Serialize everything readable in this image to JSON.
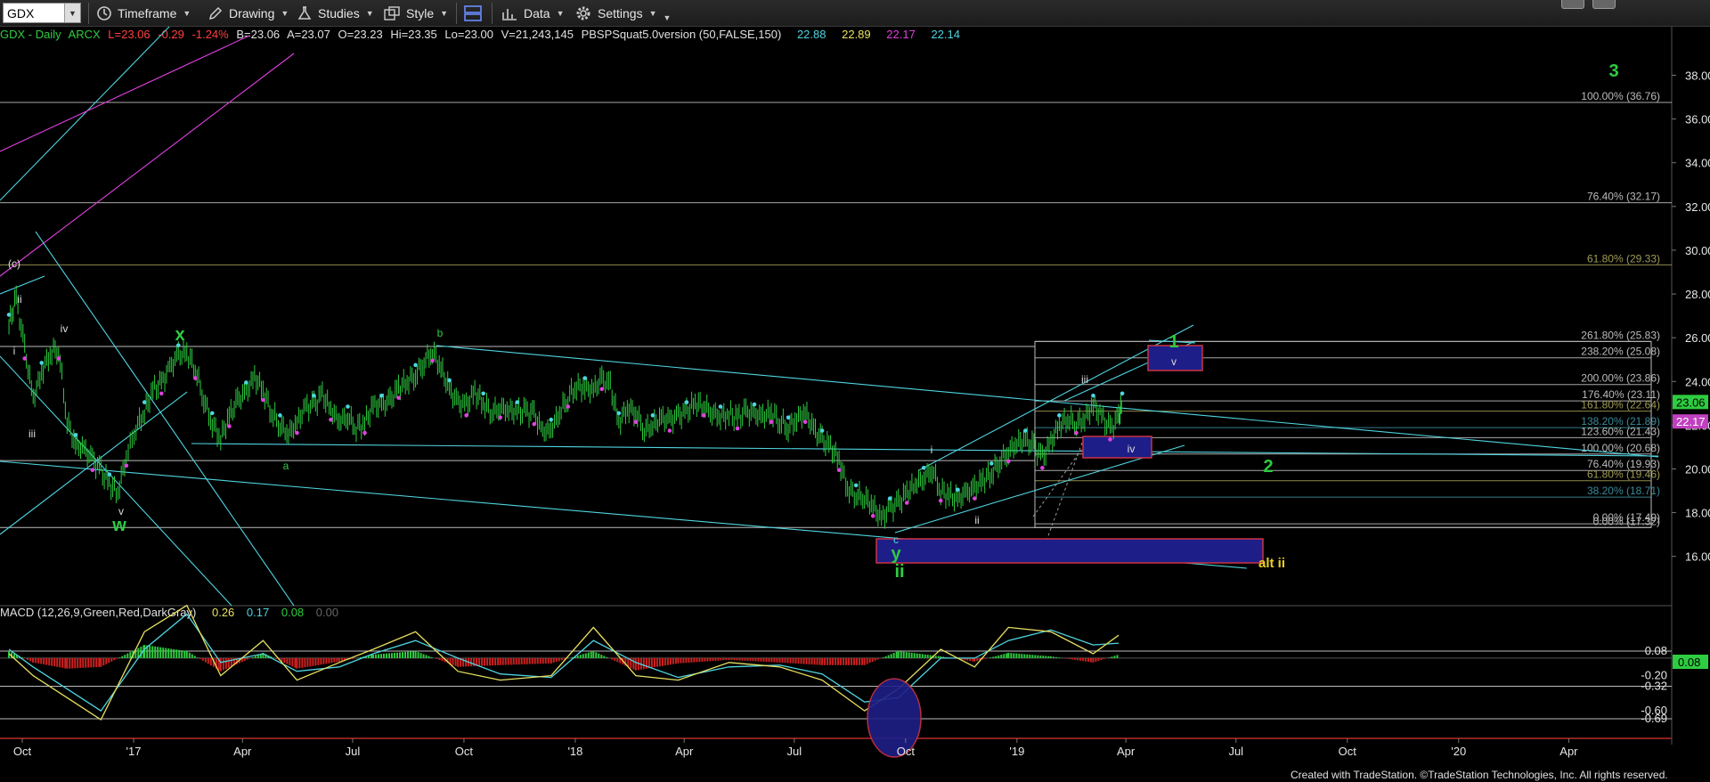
{
  "toolbar": {
    "symbol": "GDX",
    "items": [
      {
        "label": "Timeframe",
        "icon": "clock-icon"
      },
      {
        "label": "Drawing",
        "icon": "pencil-icon"
      },
      {
        "label": "Studies",
        "icon": "flask-icon"
      },
      {
        "label": "Style",
        "icon": "style-icon"
      },
      {
        "label": "",
        "icon": "layout-icon"
      },
      {
        "label": "Data",
        "icon": "data-bars-icon"
      },
      {
        "label": "Settings",
        "icon": "gear-icon"
      }
    ]
  },
  "infobar": {
    "symbol": "GDX - Daily",
    "exchange": "ARCX",
    "last": "L=23.06",
    "change": "-0.29",
    "change_pct": "-1.24%",
    "bid": "B=23.06",
    "ask": "A=23.07",
    "open": "O=23.23",
    "high": "Hi=23.35",
    "low": "Lo=23.00",
    "volume": "V=21,243,145",
    "study": "PBSPSquat5.0version (50,FALSE,150)",
    "study_values": [
      "22.88",
      "22.89",
      "22.17",
      "22.14"
    ],
    "study_colors": [
      "#4fd4e0",
      "#e8e060",
      "#e040e0",
      "#4fd4e0"
    ]
  },
  "macd_label": {
    "name": "MACD (12,26,9,Green,Red,DarkGray)",
    "values": [
      "0.26",
      "0.17",
      "0.08",
      "0.00"
    ],
    "colors": [
      "#e8e060",
      "#4fd4e0",
      "#2ecc40",
      "#666666"
    ]
  },
  "footer": "Created with TradeStation. ©TradeStation Technologies, Inc. All rights reserved.",
  "chart_data": {
    "type": "candlestick",
    "ylim": [
      14.5,
      39.5
    ],
    "y_ticks": [
      "38.00",
      "36.00",
      "34.00",
      "32.00",
      "30.00",
      "28.00",
      "26.00",
      "24.00",
      "22.00",
      "20.00",
      "18.00",
      "16.00"
    ],
    "x_ticks": [
      "Oct",
      "'17",
      "Apr",
      "Jul",
      "Oct",
      "'18",
      "Apr",
      "Jul",
      "Oct",
      "'19",
      "Apr",
      "Jul",
      "Oct",
      "'20",
      "Apr"
    ],
    "last_price_tag": {
      "value": 23.06,
      "label": "23.06",
      "color": "#2ecc40"
    },
    "study_price_tag": {
      "value": 22.17,
      "label": "22.17",
      "color": "#c040c0"
    },
    "fib_levels": [
      {
        "label": "100.00% (36.76)",
        "value": 36.76,
        "color": "#bbbbbb"
      },
      {
        "label": "76.40% (32.17)",
        "value": 32.17,
        "color": "#bbbbbb"
      },
      {
        "label": "61.80% (29.33)",
        "value": 29.33,
        "color": "#a09a55"
      },
      {
        "label": "261.80% (25.83)",
        "value": 25.83,
        "color": "#bbbbbb"
      },
      {
        "label": "238.20% (25.08)",
        "value": 25.08,
        "color": "#bbbbbb"
      },
      {
        "label": "200.00% (23.86)",
        "value": 23.86,
        "color": "#bbbbbb"
      },
      {
        "label": "176.40% (23.11)",
        "value": 23.11,
        "color": "#bbbbbb"
      },
      {
        "label": "161.80% (22.64)",
        "value": 22.64,
        "color": "#a09a55"
      },
      {
        "label": "138.20% (21.89)",
        "value": 21.89,
        "color": "#3a8a9a"
      },
      {
        "label": "123.60% (21.43)",
        "value": 21.43,
        "color": "#bbbbbb"
      },
      {
        "label": "100.00% (20.68)",
        "value": 20.68,
        "color": "#bbbbbb"
      },
      {
        "label": "76.40% (19.93)",
        "value": 19.93,
        "color": "#bbbbbb"
      },
      {
        "label": "61.80% (19.46)",
        "value": 19.46,
        "color": "#a09a55"
      },
      {
        "label": "38.20% (18.71)",
        "value": 18.71,
        "color": "#3a8a9a"
      },
      {
        "label": "0.00% (17.49)",
        "value": 17.49,
        "color": "#bbbbbb"
      },
      {
        "label": "0.00% (17.32)",
        "value": 17.32,
        "color": "#bbbbbb"
      }
    ],
    "wave_labels": [
      {
        "text": "3",
        "color": "#2ecc40",
        "size": "big"
      },
      {
        "text": "1",
        "color": "#2ecc40",
        "size": "big"
      },
      {
        "text": "2",
        "color": "#2ecc40",
        "size": "big"
      },
      {
        "text": "x",
        "color": "#2ecc40",
        "size": "big"
      },
      {
        "text": "w",
        "color": "#2ecc40",
        "size": "big"
      },
      {
        "text": "y",
        "color": "#2ecc40",
        "size": "big"
      },
      {
        "text": "ii",
        "color": "#2ecc40",
        "size": "big"
      },
      {
        "text": "alt ii",
        "color": "#e8d020",
        "size": "mid"
      },
      {
        "text": "a",
        "color": "#2ecc40",
        "size": "small"
      },
      {
        "text": "b",
        "color": "#2ecc40",
        "size": "small"
      },
      {
        "text": "c",
        "color": "#4fd4e0",
        "size": "small"
      },
      {
        "text": "(c)",
        "color": "#dddddd",
        "size": "small"
      },
      {
        "text": "ii",
        "color": "#dddddd",
        "size": "small"
      },
      {
        "text": "i",
        "color": "#dddddd",
        "size": "small"
      },
      {
        "text": "iv",
        "color": "#dddddd",
        "size": "small"
      },
      {
        "text": "iii",
        "color": "#dddddd",
        "size": "small"
      },
      {
        "text": "v",
        "color": "#dddddd",
        "size": "small"
      },
      {
        "text": "i",
        "color": "#dddddd",
        "size": "small"
      },
      {
        "text": "ii",
        "color": "#dddddd",
        "size": "small"
      },
      {
        "text": "iii",
        "color": "#dddddd",
        "size": "small"
      },
      {
        "text": "iv",
        "color": "#dddddd",
        "size": "small"
      },
      {
        "text": "v",
        "color": "#dddddd",
        "size": "small"
      }
    ],
    "price_path": [
      [
        "2016-09-20",
        26.6
      ],
      [
        "2016-09-26",
        27.8
      ],
      [
        "2016-10-03",
        25.5
      ],
      [
        "2016-10-10",
        23.2
      ],
      [
        "2016-10-17",
        24.4
      ],
      [
        "2016-10-24",
        25.3
      ],
      [
        "2016-10-31",
        25.5
      ],
      [
        "2016-11-07",
        22.2
      ],
      [
        "2016-11-14",
        21.1
      ],
      [
        "2016-11-21",
        20.9
      ],
      [
        "2016-11-28",
        20.4
      ],
      [
        "2016-12-05",
        19.9
      ],
      [
        "2016-12-12",
        19.3
      ],
      [
        "2016-12-19",
        18.9
      ],
      [
        "2016-12-26",
        20.6
      ],
      [
        "2017-01-03",
        21.9
      ],
      [
        "2017-01-10",
        22.6
      ],
      [
        "2017-01-17",
        23.6
      ],
      [
        "2017-01-24",
        23.9
      ],
      [
        "2017-01-31",
        24.6
      ],
      [
        "2017-02-07",
        25.2
      ],
      [
        "2017-02-14",
        25.3
      ],
      [
        "2017-02-21",
        24.6
      ],
      [
        "2017-02-28",
        23.2
      ],
      [
        "2017-03-07",
        22.1
      ],
      [
        "2017-03-14",
        21.4
      ],
      [
        "2017-03-21",
        22.4
      ],
      [
        "2017-03-28",
        23.1
      ],
      [
        "2017-04-04",
        23.5
      ],
      [
        "2017-04-11",
        24.2
      ],
      [
        "2017-04-18",
        23.6
      ],
      [
        "2017-04-25",
        22.6
      ],
      [
        "2017-05-02",
        22.0
      ],
      [
        "2017-05-09",
        21.6
      ],
      [
        "2017-05-16",
        22.1
      ],
      [
        "2017-05-23",
        22.8
      ],
      [
        "2017-05-30",
        22.9
      ],
      [
        "2017-06-06",
        23.4
      ],
      [
        "2017-06-13",
        22.7
      ],
      [
        "2017-06-20",
        22.2
      ],
      [
        "2017-06-27",
        22.4
      ],
      [
        "2017-07-04",
        21.9
      ],
      [
        "2017-07-11",
        22.1
      ],
      [
        "2017-07-18",
        22.9
      ],
      [
        "2017-07-25",
        22.9
      ],
      [
        "2017-08-01",
        23.1
      ],
      [
        "2017-08-08",
        23.7
      ],
      [
        "2017-08-15",
        24.0
      ],
      [
        "2017-08-22",
        24.3
      ],
      [
        "2017-08-29",
        24.9
      ],
      [
        "2017-09-05",
        25.4
      ],
      [
        "2017-09-12",
        24.6
      ],
      [
        "2017-09-19",
        23.6
      ],
      [
        "2017-09-26",
        23.0
      ],
      [
        "2017-10-03",
        22.9
      ],
      [
        "2017-10-10",
        23.5
      ],
      [
        "2017-10-17",
        23.0
      ],
      [
        "2017-10-24",
        22.6
      ],
      [
        "2017-10-31",
        22.8
      ],
      [
        "2017-11-07",
        22.7
      ],
      [
        "2017-11-14",
        22.6
      ],
      [
        "2017-11-21",
        22.6
      ],
      [
        "2017-11-28",
        22.5
      ],
      [
        "2017-12-05",
        21.7
      ],
      [
        "2017-12-12",
        21.8
      ],
      [
        "2017-12-19",
        22.6
      ],
      [
        "2017-12-26",
        23.3
      ],
      [
        "2018-01-02",
        23.8
      ],
      [
        "2018-01-09",
        23.7
      ],
      [
        "2018-01-16",
        23.6
      ],
      [
        "2018-01-23",
        24.1
      ],
      [
        "2018-01-30",
        23.8
      ],
      [
        "2018-02-06",
        22.1
      ],
      [
        "2018-02-13",
        22.8
      ],
      [
        "2018-02-20",
        22.6
      ],
      [
        "2018-02-27",
        21.8
      ],
      [
        "2018-03-06",
        22.0
      ],
      [
        "2018-03-13",
        22.3
      ],
      [
        "2018-03-20",
        22.2
      ],
      [
        "2018-03-27",
        22.4
      ],
      [
        "2018-04-03",
        22.6
      ],
      [
        "2018-04-10",
        23.0
      ],
      [
        "2018-04-17",
        22.9
      ],
      [
        "2018-04-24",
        22.6
      ],
      [
        "2018-05-01",
        22.4
      ],
      [
        "2018-05-08",
        22.5
      ],
      [
        "2018-05-15",
        22.3
      ],
      [
        "2018-05-22",
        22.6
      ],
      [
        "2018-05-29",
        22.5
      ],
      [
        "2018-06-05",
        22.4
      ],
      [
        "2018-06-12",
        22.6
      ],
      [
        "2018-06-19",
        22.2
      ],
      [
        "2018-06-26",
        21.9
      ],
      [
        "2018-07-03",
        22.3
      ],
      [
        "2018-07-10",
        22.6
      ],
      [
        "2018-07-17",
        21.8
      ],
      [
        "2018-07-24",
        21.3
      ],
      [
        "2018-07-31",
        21.0
      ],
      [
        "2018-08-07",
        20.4
      ],
      [
        "2018-08-14",
        19.1
      ],
      [
        "2018-08-21",
        18.8
      ],
      [
        "2018-08-28",
        18.7
      ],
      [
        "2018-09-04",
        18.3
      ],
      [
        "2018-09-11",
        17.7
      ],
      [
        "2018-09-18",
        18.2
      ],
      [
        "2018-09-25",
        18.4
      ],
      [
        "2018-10-02",
        18.9
      ],
      [
        "2018-10-09",
        19.3
      ],
      [
        "2018-10-16",
        19.6
      ],
      [
        "2018-10-23",
        20.0
      ],
      [
        "2018-10-30",
        19.0
      ],
      [
        "2018-11-06",
        18.8
      ],
      [
        "2018-11-13",
        18.6
      ],
      [
        "2018-11-20",
        18.9
      ],
      [
        "2018-11-27",
        19.1
      ],
      [
        "2018-12-04",
        19.5
      ],
      [
        "2018-12-11",
        19.8
      ],
      [
        "2018-12-18",
        20.4
      ],
      [
        "2018-12-25",
        20.8
      ],
      [
        "2019-01-01",
        21.2
      ],
      [
        "2019-01-08",
        21.3
      ],
      [
        "2019-01-15",
        21.0
      ],
      [
        "2019-01-22",
        20.5
      ],
      [
        "2019-01-29",
        21.2
      ],
      [
        "2019-02-05",
        22.0
      ],
      [
        "2019-02-12",
        22.3
      ],
      [
        "2019-02-19",
        22.1
      ],
      [
        "2019-02-26",
        22.3
      ],
      [
        "2019-03-05",
        22.9
      ],
      [
        "2019-03-12",
        22.4
      ],
      [
        "2019-03-19",
        21.8
      ],
      [
        "2019-03-26",
        22.3
      ],
      [
        "2019-03-29",
        23.0
      ]
    ],
    "macd_ylim": [
      -0.75,
      0.75
    ],
    "macd_ticks": [
      "0.08",
      "-0.20",
      "-0.32",
      "-0.60",
      "-0.69"
    ],
    "macd_tags": [
      {
        "label": "0.08",
        "value": 0.08,
        "color": "#2ecc40"
      }
    ],
    "macd_lines": [
      0.08,
      -0.32,
      -0.69
    ],
    "macd_histogram": [
      [
        "2016-09-20",
        0.08
      ],
      [
        "2016-10-10",
        -0.05
      ],
      [
        "2016-11-07",
        -0.12
      ],
      [
        "2016-12-05",
        -0.1
      ],
      [
        "2017-01-10",
        0.15
      ],
      [
        "2017-02-14",
        0.08
      ],
      [
        "2017-03-14",
        -0.15
      ],
      [
        "2017-04-18",
        0.06
      ],
      [
        "2017-05-16",
        -0.12
      ],
      [
        "2017-06-20",
        -0.04
      ],
      [
        "2017-07-18",
        0.04
      ],
      [
        "2017-08-22",
        0.08
      ],
      [
        "2017-09-26",
        -0.1
      ],
      [
        "2017-10-31",
        -0.08
      ],
      [
        "2017-12-12",
        -0.06
      ],
      [
        "2018-01-16",
        0.08
      ],
      [
        "2018-02-20",
        -0.14
      ],
      [
        "2018-03-27",
        -0.06
      ],
      [
        "2018-05-08",
        -0.02
      ],
      [
        "2018-06-19",
        -0.05
      ],
      [
        "2018-07-24",
        -0.08
      ],
      [
        "2018-08-28",
        -0.08
      ],
      [
        "2018-09-25",
        0.08
      ],
      [
        "2018-10-30",
        0.02
      ],
      [
        "2018-11-27",
        -0.04
      ],
      [
        "2018-12-25",
        0.06
      ],
      [
        "2019-01-29",
        0.02
      ],
      [
        "2019-03-05",
        -0.05
      ],
      [
        "2019-03-26",
        0.04
      ]
    ],
    "macd_line": [
      [
        "2016-09-20",
        0.05
      ],
      [
        "2016-10-10",
        -0.2
      ],
      [
        "2016-11-07",
        -0.45
      ],
      [
        "2016-12-05",
        -0.7
      ],
      [
        "2017-01-10",
        0.3
      ],
      [
        "2017-02-14",
        0.6
      ],
      [
        "2017-03-14",
        -0.2
      ],
      [
        "2017-04-18",
        0.2
      ],
      [
        "2017-05-16",
        -0.25
      ],
      [
        "2017-06-20",
        -0.05
      ],
      [
        "2017-07-18",
        0.1
      ],
      [
        "2017-08-22",
        0.3
      ],
      [
        "2017-09-26",
        -0.15
      ],
      [
        "2017-10-31",
        -0.25
      ],
      [
        "2017-12-12",
        -0.2
      ],
      [
        "2018-01-16",
        0.35
      ],
      [
        "2018-02-20",
        -0.2
      ],
      [
        "2018-03-27",
        -0.25
      ],
      [
        "2018-05-08",
        -0.05
      ],
      [
        "2018-06-19",
        -0.1
      ],
      [
        "2018-07-24",
        -0.25
      ],
      [
        "2018-08-28",
        -0.6
      ],
      [
        "2018-09-25",
        -0.35
      ],
      [
        "2018-10-30",
        0.1
      ],
      [
        "2018-11-27",
        -0.1
      ],
      [
        "2018-12-25",
        0.35
      ],
      [
        "2019-01-29",
        0.3
      ],
      [
        "2019-03-05",
        0.05
      ],
      [
        "2019-03-26",
        0.26
      ]
    ],
    "signal_line": [
      [
        "2016-09-20",
        0.1
      ],
      [
        "2016-10-10",
        -0.1
      ],
      [
        "2016-11-07",
        -0.35
      ],
      [
        "2016-12-05",
        -0.6
      ],
      [
        "2017-01-10",
        0.1
      ],
      [
        "2017-02-14",
        0.5
      ],
      [
        "2017-03-14",
        -0.05
      ],
      [
        "2017-04-18",
        0.05
      ],
      [
        "2017-05-16",
        -0.15
      ],
      [
        "2017-06-20",
        -0.1
      ],
      [
        "2017-07-18",
        0.05
      ],
      [
        "2017-08-22",
        0.2
      ],
      [
        "2017-09-26",
        0.0
      ],
      [
        "2017-10-31",
        -0.18
      ],
      [
        "2017-12-12",
        -0.22
      ],
      [
        "2018-01-16",
        0.2
      ],
      [
        "2018-02-20",
        -0.05
      ],
      [
        "2018-03-27",
        -0.22
      ],
      [
        "2018-05-08",
        -0.1
      ],
      [
        "2018-06-19",
        -0.08
      ],
      [
        "2018-07-24",
        -0.18
      ],
      [
        "2018-08-28",
        -0.5
      ],
      [
        "2018-09-25",
        -0.45
      ],
      [
        "2018-10-30",
        0.0
      ],
      [
        "2018-11-27",
        0.0
      ],
      [
        "2018-12-25",
        0.2
      ],
      [
        "2019-01-29",
        0.32
      ],
      [
        "2019-03-05",
        0.15
      ],
      [
        "2019-03-26",
        0.17
      ]
    ]
  }
}
